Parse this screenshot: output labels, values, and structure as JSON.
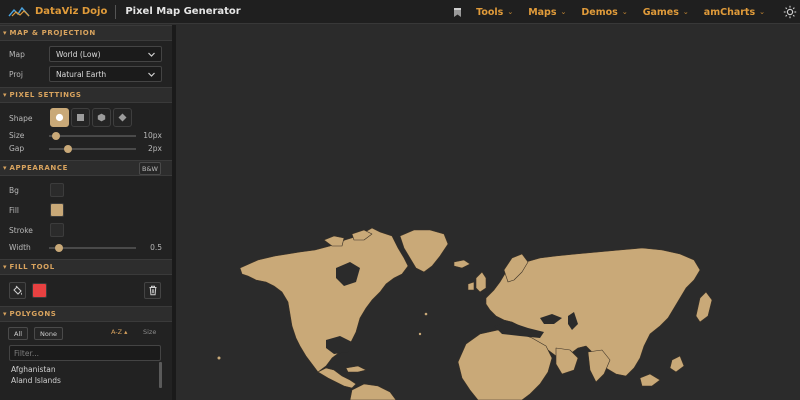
{
  "header": {
    "brand": "DataViz Dojo",
    "app_title": "Pixel Map Generator",
    "nav": [
      {
        "label": "Tools"
      },
      {
        "label": "Maps"
      },
      {
        "label": "Demos"
      },
      {
        "label": "Games"
      },
      {
        "label": "amCharts"
      }
    ]
  },
  "sections": {
    "map_projection": "MAP & PROJECTION",
    "pixel_settings": "PIXEL SETTINGS",
    "appearance": "APPEARANCE",
    "fill_tool": "FILL TOOL",
    "polygons": "POLYGONS"
  },
  "map_projection": {
    "map_label": "Map",
    "map_value": "World (Low)",
    "proj_label": "Proj",
    "proj_value": "Natural Earth"
  },
  "pixel_settings": {
    "shape_label": "Shape",
    "shapes": [
      "circle",
      "square",
      "hexagon",
      "diamond"
    ],
    "selected_shape": "circle",
    "size_label": "Size",
    "size_value": "10px",
    "size_fraction": 0.08,
    "gap_label": "Gap",
    "gap_value": "2px",
    "gap_fraction": 0.22
  },
  "appearance": {
    "bw_label": "B&W",
    "bg_label": "Bg",
    "bg_color": "#2b2b2b",
    "fill_label": "Fill",
    "fill_color": "#c9a978",
    "stroke_label": "Stroke",
    "stroke_color": "#2b2b2b",
    "width_label": "Width",
    "width_value": "0.5",
    "width_fraction": 0.12
  },
  "fill_tool": {
    "color": "#e84141"
  },
  "polygons": {
    "all_label": "All",
    "none_label": "None",
    "sort_az_label": "A-Z ▴",
    "sort_size_label": "Size",
    "filter_placeholder": "Filter...",
    "items": [
      "Afghanistan",
      "Aland Islands"
    ]
  },
  "colors": {
    "accent": "#e09b3a",
    "land": "#c9a978",
    "background": "#2b2b2b"
  }
}
